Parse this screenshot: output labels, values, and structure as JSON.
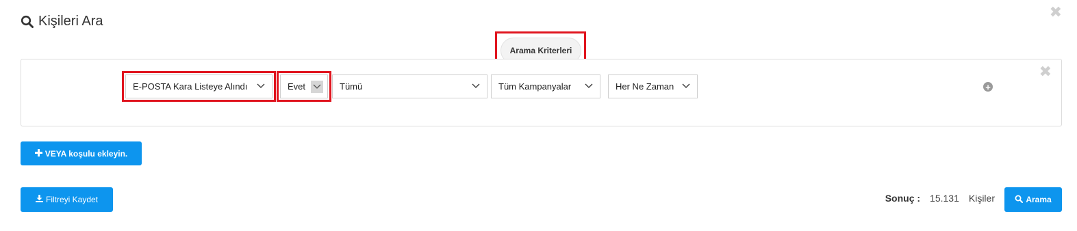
{
  "header": {
    "title": "Kişileri Ara",
    "icon": "search-icon"
  },
  "criteria": {
    "label": "Arama Kriterleri"
  },
  "filter_row": {
    "field": "E-POSTA Kara Listeye Alındı",
    "value": "Evet",
    "scope": "Tümü",
    "campaign": "Tüm Kampanyalar",
    "time": "Her Ne Zaman"
  },
  "buttons": {
    "add_or": "VEYA koşulu ekleyin.",
    "save_filter": "Filtreyi Kaydet",
    "search": "Arama"
  },
  "result": {
    "label": "Sonuç :",
    "count": "15.131",
    "unit": "Kişiler"
  },
  "colors": {
    "accent": "#0d95ee",
    "highlight": "#e0141e"
  }
}
